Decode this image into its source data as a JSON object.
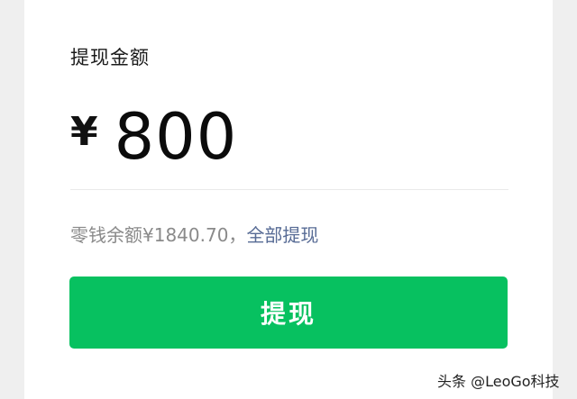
{
  "withdraw": {
    "label": "提现金额",
    "currency_symbol": "¥",
    "amount": "800",
    "balance_text": "零钱余额¥1840.70，",
    "withdraw_all_label": "全部提现",
    "button_label": "提现"
  },
  "watermark": {
    "text": "头条 @LeoGo科技"
  },
  "colors": {
    "button": "#07c160",
    "link": "#576b95",
    "secondary_text": "#8a8a8a",
    "background": "#efefef"
  }
}
